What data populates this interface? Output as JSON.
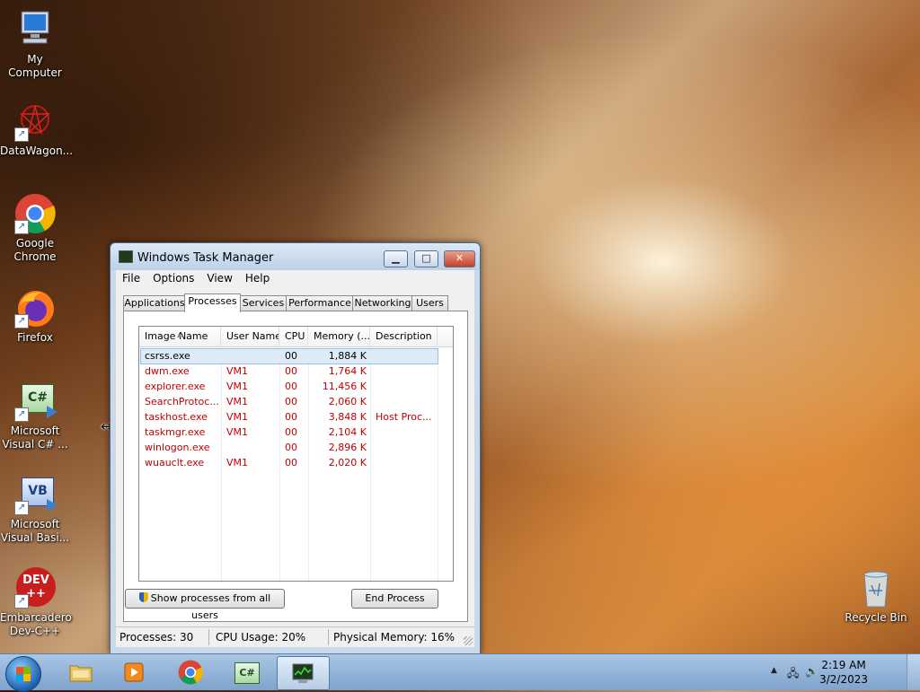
{
  "desktop": {
    "icons": [
      {
        "label": "My Computer"
      },
      {
        "label": "DataWagon..."
      },
      {
        "label": "Google Chrome"
      },
      {
        "label": "Firefox"
      },
      {
        "label": "Microsoft Visual C# ..."
      },
      {
        "label": "Microsoft Visual Basi..."
      },
      {
        "label": "Embarcadero Dev-C++"
      },
      {
        "label": "Recycle Bin"
      }
    ],
    "csharp_glyph": "C#",
    "vb_glyph": "VB",
    "dev_glyph": "DEV",
    "dev_sub_glyph": "++"
  },
  "window": {
    "title": "Windows Task Manager",
    "menu": [
      "File",
      "Options",
      "View",
      "Help"
    ],
    "tabs": [
      "Applications",
      "Processes",
      "Services",
      "Performance",
      "Networking",
      "Users"
    ],
    "active_tab": "Processes",
    "columns": [
      "Image Name",
      "User Name",
      "CPU",
      "Memory (...",
      "Description"
    ],
    "processes": [
      {
        "name": "csrss.exe",
        "user": "",
        "cpu": "00",
        "memory": "1,884 K",
        "description": "",
        "color": "#000000",
        "selected": true
      },
      {
        "name": "dwm.exe",
        "user": "VM1",
        "cpu": "00",
        "memory": "1,764 K",
        "description": "",
        "color": "#c00000"
      },
      {
        "name": "explorer.exe",
        "user": "VM1",
        "cpu": "00",
        "memory": "11,456 K",
        "description": "",
        "color": "#c00000"
      },
      {
        "name": "SearchProtoc...",
        "user": "VM1",
        "cpu": "00",
        "memory": "2,060 K",
        "description": "",
        "color": "#c00000"
      },
      {
        "name": "taskhost.exe",
        "user": "VM1",
        "cpu": "00",
        "memory": "3,848 K",
        "description": "Host Proc...",
        "color": "#c00000"
      },
      {
        "name": "taskmgr.exe",
        "user": "VM1",
        "cpu": "00",
        "memory": "2,104 K",
        "description": "",
        "color": "#c00000"
      },
      {
        "name": "winlogon.exe",
        "user": "",
        "cpu": "00",
        "memory": "2,896 K",
        "description": "",
        "color": "#c00000"
      },
      {
        "name": "wuauclt.exe",
        "user": "VM1",
        "cpu": "00",
        "memory": "2,020 K",
        "description": "",
        "color": "#c00000"
      }
    ],
    "show_all_label": "Show processes from all users",
    "end_process_label": "End Process",
    "status": {
      "processes": "Processes: 30",
      "cpu": "CPU Usage: 20%",
      "memory": "Physical Memory: 16%"
    }
  },
  "taskbar": {
    "clock_time": "2:19 AM",
    "clock_date": "3/2/2023",
    "csharp_glyph": "C#",
    "colors": {
      "accent": "#1c5fb0",
      "process_red": "#c00000"
    }
  }
}
